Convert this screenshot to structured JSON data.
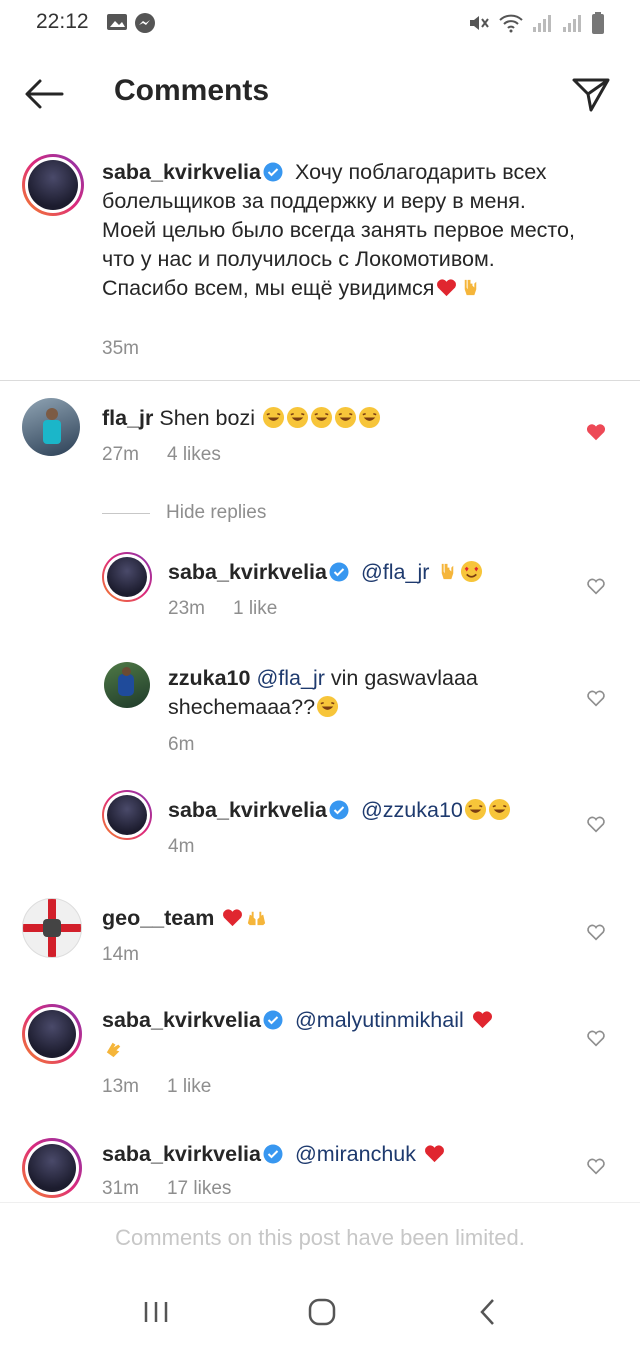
{
  "status_bar": {
    "time": "22:12"
  },
  "header": {
    "title": "Comments"
  },
  "caption": {
    "username": "saba_kvirkvelia",
    "text": "Хочу поблагодарить всех болельщиков за поддержку и веру в меня. Моей целью было всегда занять первое место, что у нас и получилось с Локомотивом. Спасибо всем, мы ещё увидимся",
    "time": "35m"
  },
  "comments": [
    {
      "username": "fla_jr",
      "text": "Shen bozi",
      "time": "27m",
      "likes": "4 likes",
      "liked": true
    },
    {
      "username": "geo__team",
      "text": "",
      "time": "14m"
    },
    {
      "username": "saba_kvirkvelia",
      "mention": "@malyutinmikhail",
      "time": "13m",
      "likes": "1 like"
    },
    {
      "username": "saba_kvirkvelia",
      "mention": "@miranchuk",
      "time": "31m",
      "likes": "17 likes"
    }
  ],
  "hide_replies_label": "Hide replies",
  "replies": [
    {
      "username": "saba_kvirkvelia",
      "mention": "@fla_jr",
      "time": "23m",
      "likes": "1 like"
    },
    {
      "username": "zzuka10",
      "mention": "@fla_jr",
      "text_line1": "vin gaswavlaaa",
      "text_line2": "shechemaaa??",
      "time": "6m"
    },
    {
      "username": "saba_kvirkvelia",
      "mention": "@zzuka10",
      "time": "4m"
    }
  ],
  "footer": {
    "text": "Comments on this post have been limited."
  },
  "colors": {
    "like_red": "#ed4956",
    "verified_blue": "#3897f0",
    "mention": "#1e3a6e"
  }
}
